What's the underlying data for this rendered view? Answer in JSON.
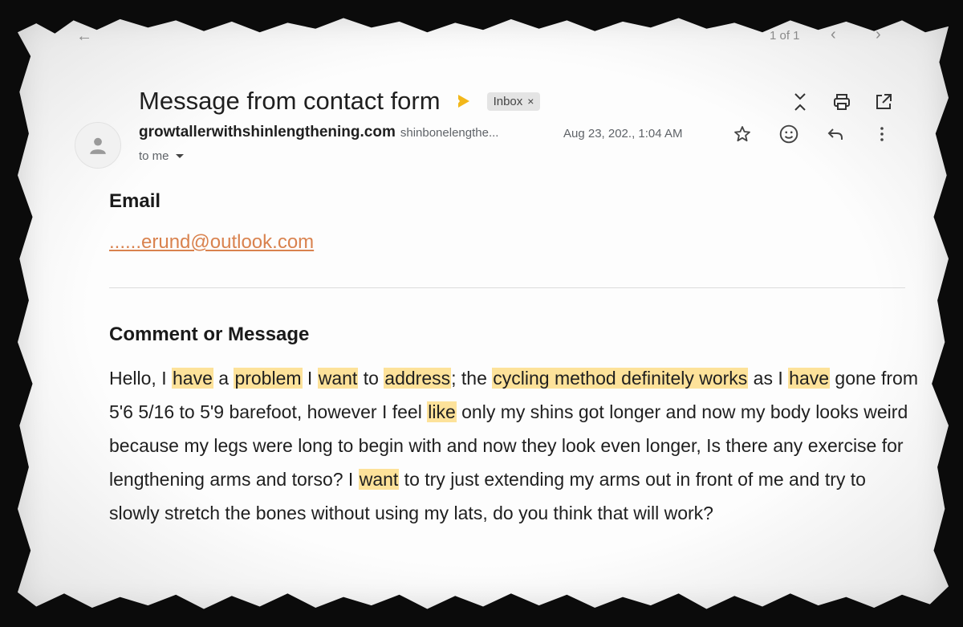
{
  "toolbar": {
    "pager": "1 of 1"
  },
  "header": {
    "subject": "Message from contact form",
    "label_chip": "Inbox",
    "chip_close": "×"
  },
  "sender": {
    "name": "growtallerwithshinlengthening.com",
    "email": "shinbonelengthe...",
    "timestamp": "Aug 23, 202., 1:04 AM",
    "recipient": "to me"
  },
  "body": {
    "email_label": "Email",
    "email_value": "......erund@outlook.com",
    "comment_label": "Comment or Message",
    "message_segments": [
      {
        "text": "Hello, I ",
        "hl": false
      },
      {
        "text": "have",
        "hl": true
      },
      {
        "text": " a ",
        "hl": false
      },
      {
        "text": "problem",
        "hl": true
      },
      {
        "text": " I ",
        "hl": false
      },
      {
        "text": "want",
        "hl": true
      },
      {
        "text": " to ",
        "hl": false
      },
      {
        "text": "address",
        "hl": true
      },
      {
        "text": "; the ",
        "hl": false
      },
      {
        "text": "cycling method definitely works",
        "hl": true
      },
      {
        "text": " as I ",
        "hl": false
      },
      {
        "text": "have",
        "hl": true
      },
      {
        "text": " gone from 5'6 5/16 to 5'9 barefoot, however I feel ",
        "hl": false
      },
      {
        "text": "like",
        "hl": true
      },
      {
        "text": " only my shins got longer and now my body looks weird because my legs were long to begin with and now they look even longer, Is there any exercise for lengthening arms and torso? I ",
        "hl": false
      },
      {
        "text": "want",
        "hl": true
      },
      {
        "text": " to try just extending my arms out in front of me and try to slowly stretch the bones without using my lats, do you think that will work?",
        "hl": false
      }
    ]
  },
  "colors": {
    "highlight": "#fde29a",
    "link": "#d9824e",
    "importance": "#f2b71a"
  },
  "icons": [
    "back-icon",
    "prev-icon",
    "next-icon",
    "importance-icon",
    "expand-collapse-icon",
    "print-icon",
    "open-in-new-icon",
    "avatar-person-icon",
    "star-icon",
    "emoji-icon",
    "reply-icon",
    "more-vert-icon",
    "caret-down-icon"
  ]
}
